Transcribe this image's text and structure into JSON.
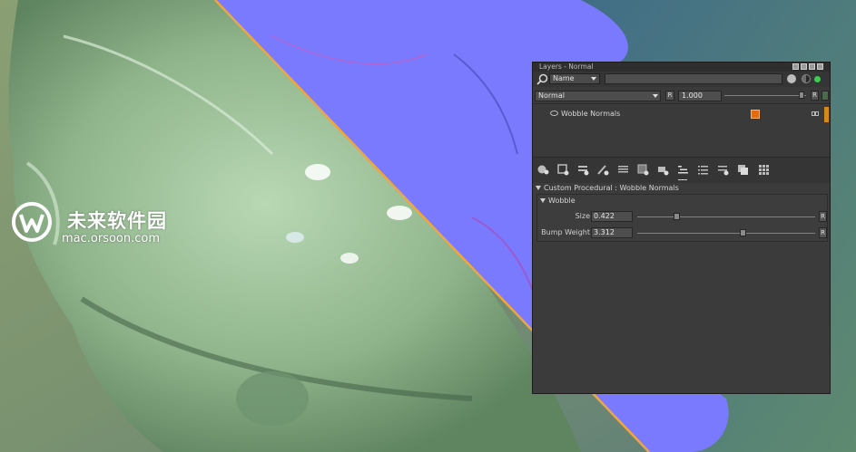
{
  "window": {
    "title": "Layers - Normal"
  },
  "watermark": {
    "title": "未来软件园",
    "url": "mac.orsoon.com"
  },
  "search": {
    "field_select": "Name",
    "value": "",
    "placeholder": ""
  },
  "layer_settings": {
    "blend_mode": "Normal",
    "reset_label": "R",
    "opacity": "1.000",
    "opacity_fraction": 1.0
  },
  "layers": [
    {
      "name": "Wobble Normals",
      "visible": true,
      "icon": "procedural-layer-icon",
      "color": "#d38a1a"
    }
  ],
  "toolbar": {
    "icons": [
      "add-layer-icon",
      "add-paint-layer-icon",
      "add-fill-layer-icon",
      "add-procedural-layer-icon",
      "add-adjustment-layer-icon",
      "add-mask-icon",
      "add-group-icon",
      "sort-layers-icon",
      "layer-list-icon",
      "remove-layer-icon",
      "copy-layer-icon",
      "grid-view-icon"
    ]
  },
  "properties": {
    "section_title": "Custom Procedural : Wobble Normals",
    "group_title": "Wobble",
    "params": [
      {
        "label": "Size",
        "value": "0.422",
        "fraction": 0.22,
        "reset": "R"
      },
      {
        "label": "Bump Weight",
        "value": "3.312",
        "fraction": 0.59,
        "reset": "R"
      }
    ]
  },
  "colors": {
    "viewport_green": "#7f9f7c",
    "normal_map_blue": "#7a7aff",
    "split_line": "#f0a63a",
    "panel_bg": "#3a3a3a",
    "accent_orange": "#e46a10",
    "status_green": "#38d24a"
  }
}
